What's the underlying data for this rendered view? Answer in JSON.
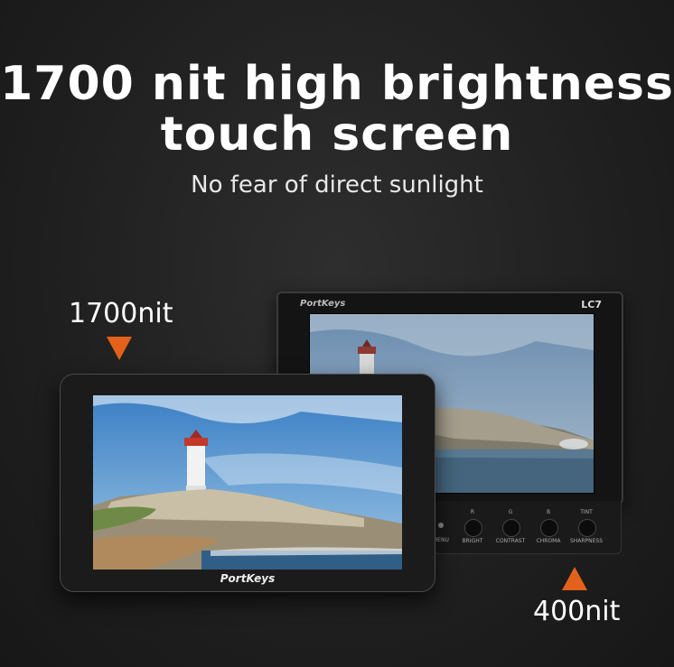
{
  "headline": {
    "line1": "1700 nit high brightness",
    "line2": "touch screen",
    "subtitle": "No fear of direct sunlight"
  },
  "callouts": {
    "front_brightness": "1700nit",
    "back_brightness": "400nit",
    "arrow_color": "#e2621b"
  },
  "front_monitor": {
    "brand": "PortKeys"
  },
  "back_monitor": {
    "brand": "PortKeys",
    "model": "LC7",
    "menu_label": "MENU",
    "controls": [
      {
        "top": "R",
        "bottom": "BRIGHT"
      },
      {
        "top": "G",
        "bottom": "CONTRAST"
      },
      {
        "top": "B",
        "bottom": "CHROMA"
      },
      {
        "top": "TINT",
        "bottom": "SHARPNESS"
      }
    ]
  },
  "screen_image": "lighthouse-on-rocky-coast-scene"
}
